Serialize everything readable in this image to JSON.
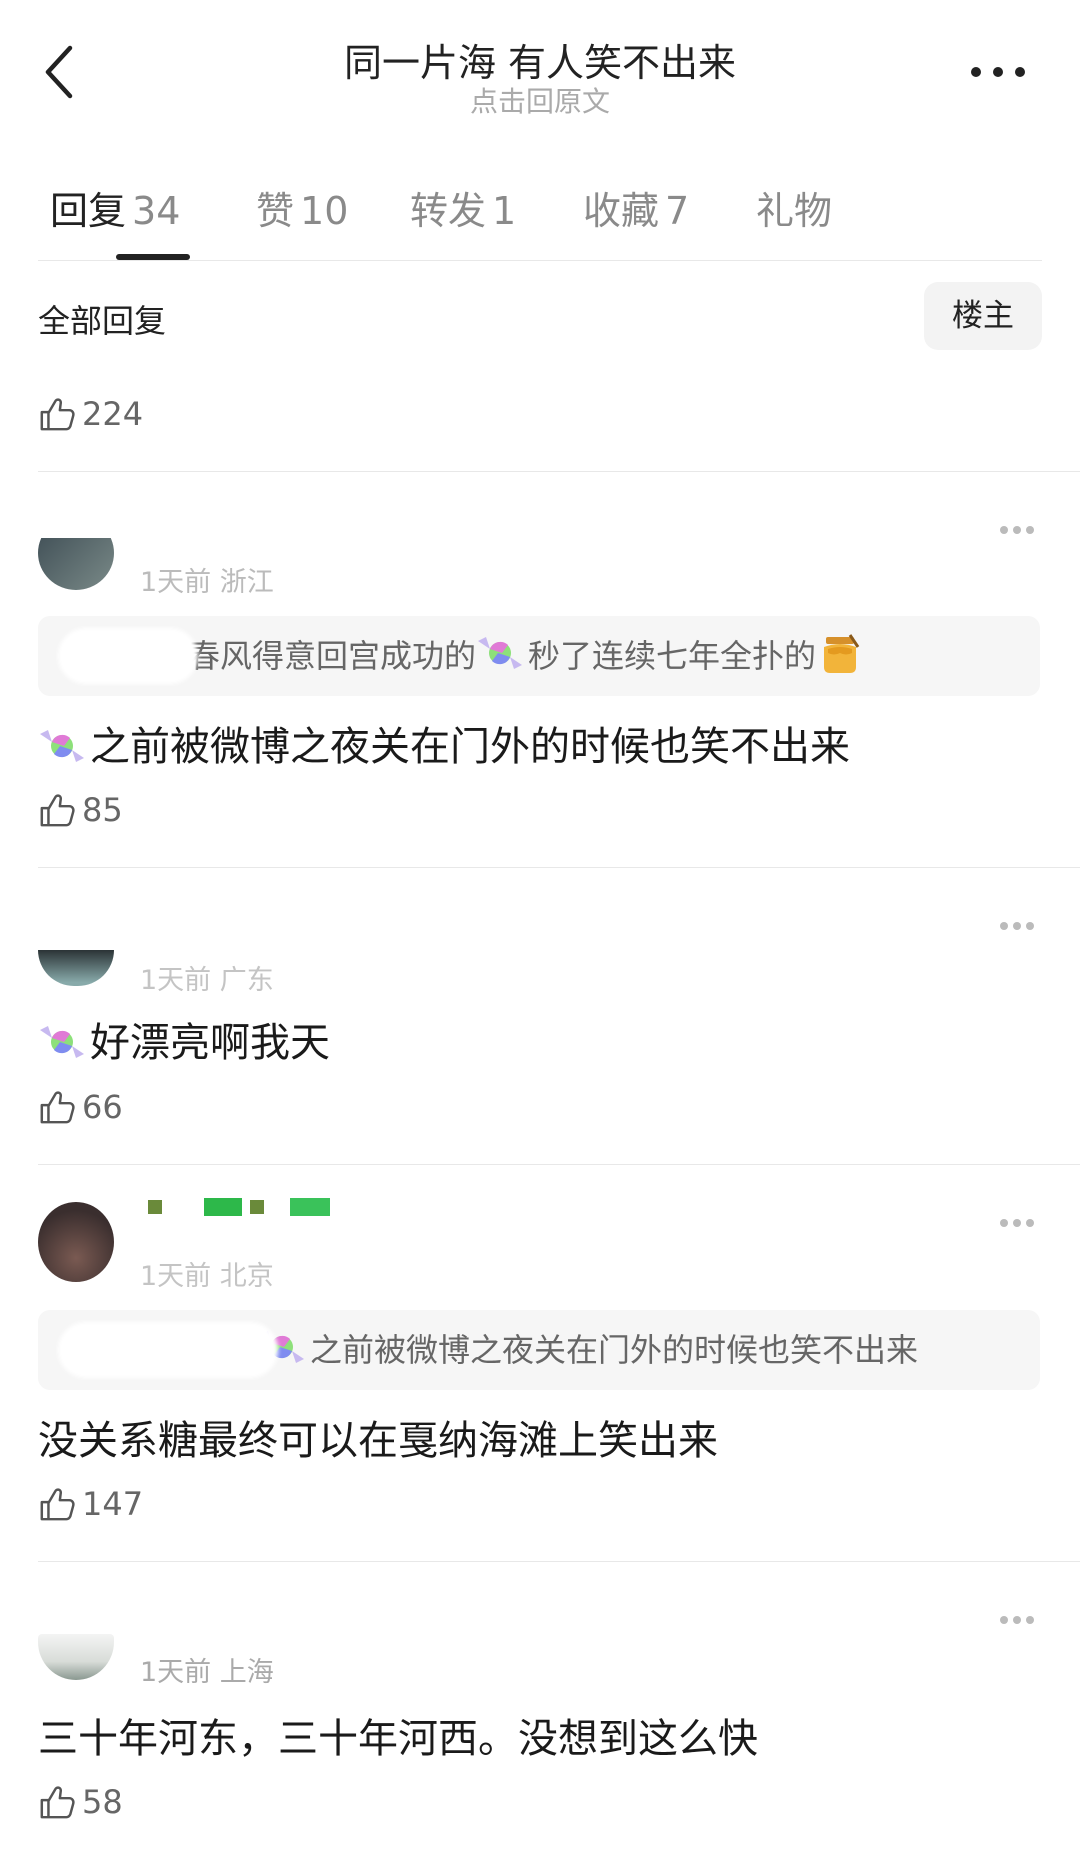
{
  "header": {
    "title": "同一片海 有人笑不出来",
    "subtitle": "点击回原文"
  },
  "tabs": [
    {
      "label": "回复",
      "count": "34"
    },
    {
      "label": "赞",
      "count": "10"
    },
    {
      "label": "转发",
      "count": "1"
    },
    {
      "label": "收藏",
      "count": "7"
    },
    {
      "label": "礼物",
      "count": ""
    }
  ],
  "filter": {
    "title": "全部回复",
    "owner_button": "楼主"
  },
  "comments": [
    {
      "likes": "224"
    },
    {
      "meta": "1天前 浙江",
      "quote_text": "春风得意回宫成功的",
      "quote_text2": "秒了连续七年全扑的",
      "text": "之前被微博之夜关在门外的时候也笑不出来",
      "likes": "85"
    },
    {
      "meta": "1天前 广东",
      "text": "好漂亮啊我天",
      "likes": "66"
    },
    {
      "meta": "1天前 北京",
      "quote_text": "之前被微博之夜关在门外的时候也笑不出来",
      "text": "没关系糖最终可以在戛纳海滩上笑出来",
      "likes": "147"
    },
    {
      "meta": "1天前 上海",
      "text": "三十年河东，三十年河西。没想到这么快",
      "likes": "58"
    }
  ],
  "icons": {
    "back": "chevron-left-icon",
    "more": "more-horizontal-icon",
    "like": "thumbs-up-icon",
    "candy": "candy-emoji",
    "honey": "honey-pot-emoji"
  },
  "colors": {
    "text_primary": "#222222",
    "text_secondary": "#8a8a8a",
    "meta": "#aaaaaa",
    "quote_bg": "#f6f6f6",
    "divider": "#e8e8e8"
  }
}
